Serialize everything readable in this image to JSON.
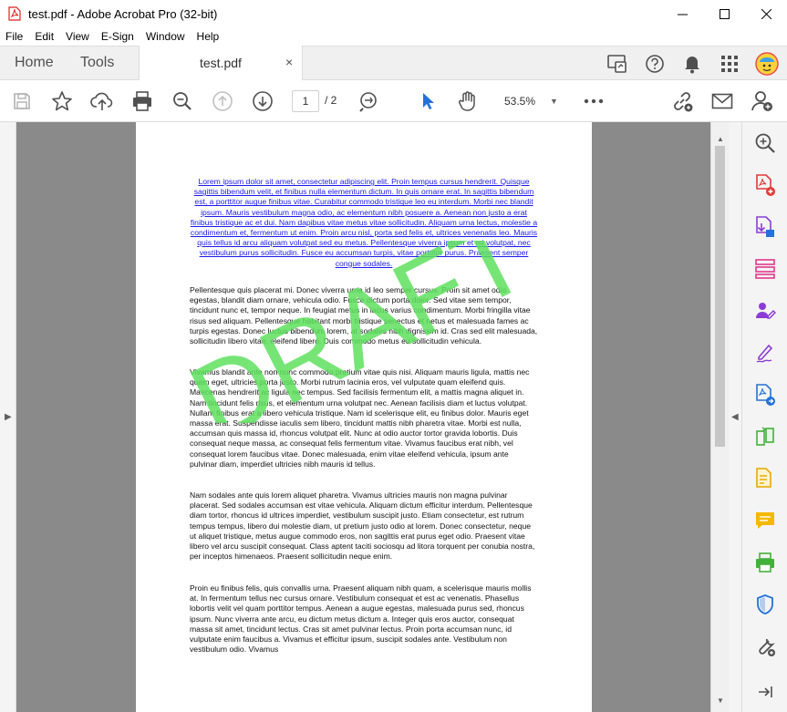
{
  "window": {
    "title": "test.pdf - Adobe Acrobat Pro (32-bit)"
  },
  "menu": [
    "File",
    "Edit",
    "View",
    "E-Sign",
    "Window",
    "Help"
  ],
  "tabs": {
    "home": "Home",
    "tools": "Tools",
    "document": "test.pdf",
    "close": "×"
  },
  "toolbar": {
    "current_page": "1",
    "page_sep": "/  2",
    "zoom": "53.5%"
  },
  "document": {
    "link_paragraph": "Lorem ipsum dolor sit amet, consectetur adipiscing elit. Proin tempus cursus hendrerit. Quisque sagittis bibendum velit, et finibus nulla elementum dictum. In quis ornare erat. In sagittis bibendum est, a porttitor augue finibus vitae. Curabitur commodo tristique leo eu interdum. Morbi nec blandit ipsum. Mauris vestibulum magna odio, ac elementum nibh posuere a. Aenean non justo a erat finibus tristique ac et dui. Nam dapibus vitae metus vitae sollicitudin. Aliquam urna lectus, molestie a condimentum et, fermentum ut enim. Proin arcu nisl, porta sed felis et, ultrices venenatis leo. Mauris quis tellus id arcu aliquam volutpat sed eu metus. Pellentesque viverra ipsum et mi volutpat, nec vestibulum purus sollicitudin. Fusce eu accumsan turpis, vitae porttitor purus. Praesent semper congue sodales.",
    "paragraphs": [
      "Pellentesque quis placerat mi. Donec viverra urna id leo semper cursus. Proin sit amet odio egestas, blandit diam ornare, vehicula odio. Fusce dictum porta dolor. Sed vitae sem tempor, tincidunt nunc et, tempor neque. In feugiat metus in lacus varius condimentum. Morbi fringilla vitae risus sed aliquam. Pellentesque habitant morbi tristique senectus et netus et malesuada fames ac turpis egestas. Donec luctus bibendum lorem, at sodales nibh dignissim id. Cras sed elit malesuada, sollicitudin libero vitae, eleifend libero. Duis commodo metus eu sollicitudin vehicula.",
      "Vivamus blandit ante non nunc commodo pretium vitae quis nisi. Aliquam mauris ligula, mattis nec quam eget, ultricies porta justo. Morbi rutrum lacinia eros, vel vulputate quam eleifend quis. Maecenas hendrerit ac ligula nec tempus. Sed facilisis fermentum elit, a mattis magna aliquet in. Nam tincidunt felis risus, et elementum urna volutpat nec. Aenean facilisis diam et luctus volutpat. Nullam finibus erat a libero vehicula tristique. Nam id scelerisque elit, eu finibus dolor. Mauris eget massa erat. Suspendisse iaculis sem libero, tincidunt mattis nibh pharetra vitae. Morbi est nulla, accumsan quis massa id, rhoncus volutpat elit. Nunc at odio auctor tortor gravida lobortis. Duis consequat neque massa, ac consequat felis fermentum vitae. Vivamus faucibus erat nibh, vel consequat lorem faucibus vitae. Donec malesuada, enim vitae eleifend vehicula, ipsum ante pulvinar diam, imperdiet ultricies nibh mauris id tellus.",
      "Nam sodales ante quis lorem aliquet pharetra. Vivamus ultricies mauris non magna pulvinar placerat. Sed sodales accumsan est vitae vehicula. Aliquam dictum efficitur interdum. Pellentesque diam tortor, rhoncus id ultrices imperdiet, vestibulum suscipit justo. Etiam consectetur, est rutrum tempus tempus, libero dui molestie diam, ut pretium justo odio at lorem. Donec consectetur, neque ut aliquet tristique, metus augue commodo eros, non sagittis erat purus eget odio. Praesent vitae libero vel arcu suscipit consequat. Class aptent taciti sociosqu ad litora torquent per conubia nostra, per inceptos himenaeos. Praesent sollicitudin neque enim.",
      "Proin eu finibus felis, quis convallis urna. Praesent aliquam nibh quam, a scelerisque mauris mollis at. In fermentum tellus nec cursus ornare. Vestibulum consequat et est ac venenatis. Phasellus lobortis velit vel quam porttitor tempus. Aenean a augue egestas, malesuada purus sed, rhoncus ipsum. Nunc viverra ante arcu, eu dictum metus dictum a. Integer quis eros auctor, consequat massa sit amet, tincidunt lectus. Cras sit amet pulvinar lectus. Proin porta accumsan nunc, id vulputate enim faucibus a. Vivamus et efficitur ipsum, suscipit sodales ante. Vestibulum non vestibulum odio. Vivamus"
    ],
    "watermark": "DRAFT"
  },
  "colors": {
    "link": "#1a1aee",
    "watermark": "#5ee05e",
    "accent_blue": "#2372d9",
    "tool_purple": "#8b3cd6",
    "tool_red": "#e03a3a"
  }
}
